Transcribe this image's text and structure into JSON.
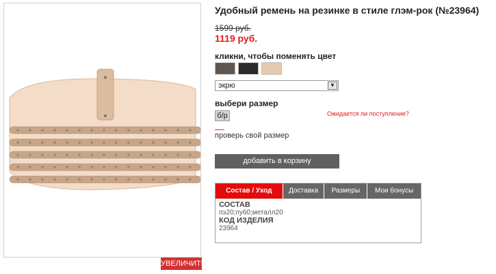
{
  "product": {
    "title": "Удобный ремень на резинке в стиле глэм-рок (№23964)",
    "old_price": "1599 руб.",
    "new_price": "1119 руб."
  },
  "colors": {
    "label": "кликни, чтобы поменять цвет",
    "selected": "экрю"
  },
  "size": {
    "label": "выбери размер",
    "option": "б/р",
    "expect_link": "Ожидается ли поступление?",
    "check_size": "проверь свой размер"
  },
  "actions": {
    "zoom": "УВЕЛИЧИТЬ",
    "add_to_cart": "добавить в корзину"
  },
  "tabs": [
    {
      "label": "Состав / Уход"
    },
    {
      "label": "Доставка"
    },
    {
      "label": "Размеры"
    },
    {
      "label": "Мои бонусы"
    }
  ],
  "details": {
    "composition_title": "СОСТАВ",
    "composition_value": "пэ20;пу60;металл20",
    "code_title": "КОД ИЗДЕЛИЯ",
    "code_value": "23964"
  }
}
